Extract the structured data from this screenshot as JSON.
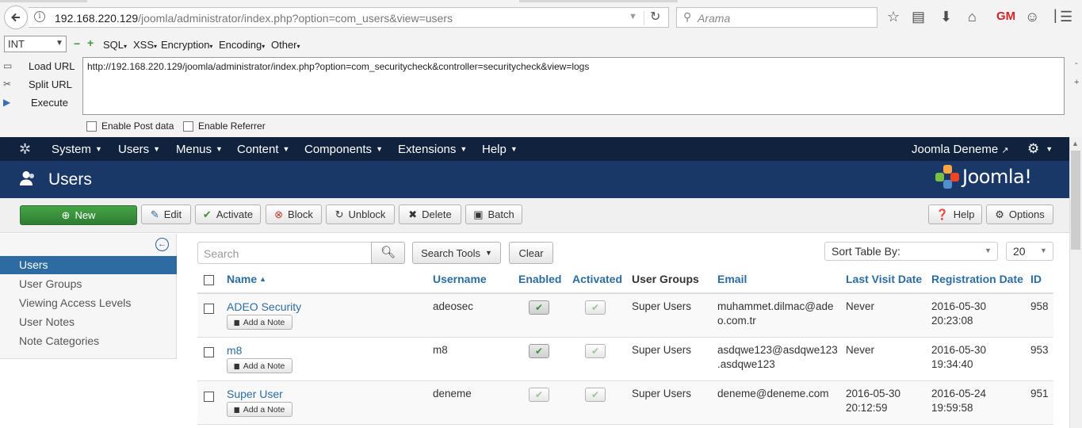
{
  "browser": {
    "url_host": "192.168.220.129",
    "url_path": "/joomla/administrator/index.php?option=com_users&view=users",
    "search_placeholder": "Arama"
  },
  "hackbar": {
    "select_value": "INT",
    "menus": [
      "SQL",
      "XSS",
      "Encryption",
      "Encoding",
      "Other"
    ],
    "commands": [
      "Load URL",
      "Split URL",
      "Execute"
    ],
    "url_value": "http://192.168.220.129/joomla/administrator/index.php?option=com_securitycheck&controller=securitycheck&view=logs",
    "enable_post": "Enable Post data",
    "enable_referrer": "Enable Referrer"
  },
  "nav": {
    "menus": [
      "System",
      "Users",
      "Menus",
      "Content",
      "Components",
      "Extensions",
      "Help"
    ],
    "site_name": "Joomla Deneme"
  },
  "header": {
    "title": "Users",
    "brand": "Joomla!"
  },
  "toolbar": {
    "new": "New",
    "edit": "Edit",
    "activate": "Activate",
    "block": "Block",
    "unblock": "Unblock",
    "delete": "Delete",
    "batch": "Batch",
    "help": "Help",
    "options": "Options"
  },
  "sidebar": {
    "items": [
      "Users",
      "User Groups",
      "Viewing Access Levels",
      "User Notes",
      "Note Categories"
    ],
    "active_index": 0
  },
  "filters": {
    "search_placeholder": "Search",
    "search_tools": "Search Tools",
    "clear": "Clear",
    "sort_by": "Sort Table By:",
    "limit": "20"
  },
  "table": {
    "headers": [
      "Name",
      "Username",
      "Enabled",
      "Activated",
      "User Groups",
      "Email",
      "Last Visit Date",
      "Registration Date",
      "ID"
    ],
    "note_button": "Add a Note",
    "rows": [
      {
        "name": "ADEO Security",
        "username": "adeosec",
        "enabled": true,
        "activated": true,
        "groups": "Super Users",
        "email_1": "muhammet.dilmac@ade",
        "email_2": "o.com.tr",
        "last_visit_1": "Never",
        "last_visit_2": "",
        "reg_1": "2016-05-30",
        "reg_2": "20:23:08",
        "id": "958"
      },
      {
        "name": "m8",
        "username": "m8",
        "enabled": true,
        "activated": true,
        "groups": "Super Users",
        "email_1": "asdqwe123@asdqwe123",
        "email_2": ".asdqwe123",
        "last_visit_1": "Never",
        "last_visit_2": "",
        "reg_1": "2016-05-30",
        "reg_2": "19:34:40",
        "id": "953"
      },
      {
        "name": "Super User",
        "username": "deneme",
        "enabled": true,
        "activated": true,
        "groups": "Super Users",
        "email_1": "deneme@deneme.com",
        "email_2": "",
        "last_visit_1": "2016-05-30",
        "last_visit_2": "20:12:59",
        "reg_1": "2016-05-24",
        "reg_2": "19:59:58",
        "id": "951"
      }
    ]
  }
}
